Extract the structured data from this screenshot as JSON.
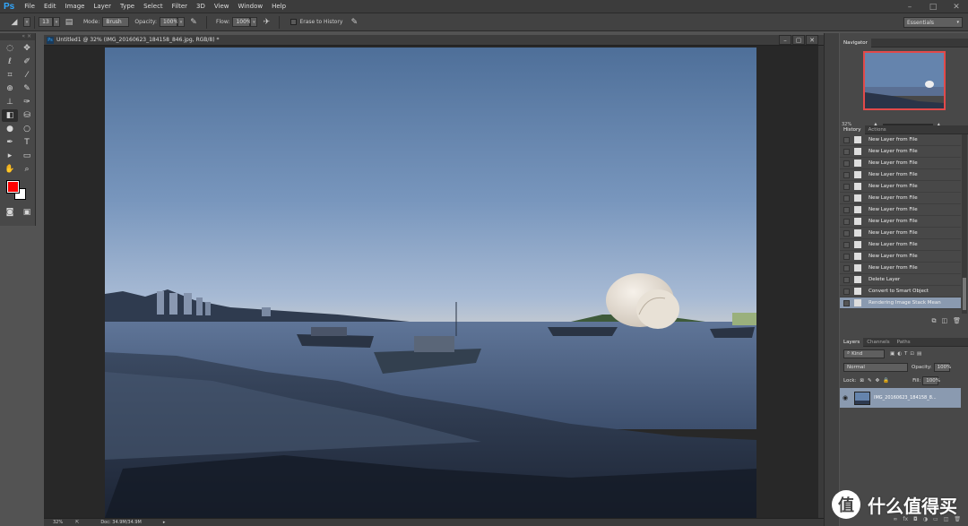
{
  "app": {
    "logo": "Ps",
    "menus": [
      "File",
      "Edit",
      "Image",
      "Layer",
      "Type",
      "Select",
      "Filter",
      "3D",
      "View",
      "Window",
      "Help"
    ]
  },
  "options_bar": {
    "brush_size": "13",
    "mode_label": "Mode:",
    "mode_value": "Brush",
    "opacity_label": "Opacity:",
    "opacity_value": "100%",
    "flow_label": "Flow:",
    "flow_value": "100%",
    "erase_to_history": "Erase to History",
    "workspace": "Essentials"
  },
  "colors": {
    "foreground": "#ff0000",
    "background": "#ffffff",
    "accent": "#31a8ff",
    "selection": "#8a9ab0"
  },
  "document": {
    "title": "Untitled1 @ 32% (IMG_20160623_184158_846.jpg, RGB/8) *",
    "zoom": "32%",
    "doc_size": "Doc: 34.9M/34.9M"
  },
  "navigator": {
    "tab": "Navigator",
    "zoom": "32%"
  },
  "history": {
    "tabs": [
      "History",
      "Actions"
    ],
    "items": [
      "New Layer from File",
      "New Layer from File",
      "New Layer from File",
      "New Layer from File",
      "New Layer from File",
      "New Layer from File",
      "New Layer from File",
      "New Layer from File",
      "New Layer from File",
      "New Layer from File",
      "New Layer from File",
      "New Layer from File",
      "Delete Layer",
      "Convert to Smart Object",
      "Rendering Image Stack Mean"
    ]
  },
  "layers": {
    "tabs": [
      "Layers",
      "Channels",
      "Paths"
    ],
    "filter": "Kind",
    "blend_mode": "Normal",
    "opacity_label": "Opacity:",
    "opacity_value": "100%",
    "lock_label": "Lock:",
    "fill_label": "Fill:",
    "fill_value": "100%",
    "layer_name": "IMG_20160623_184158_8..."
  },
  "watermark": {
    "glyph": "值",
    "text": "什么值得买"
  }
}
